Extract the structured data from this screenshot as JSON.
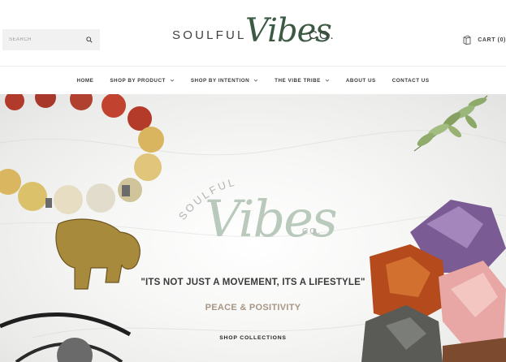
{
  "header": {
    "search": {
      "placeholder": "SEARCH",
      "icon": "search-icon"
    },
    "logo": {
      "word1": "SOULFUL",
      "word2": "Vibes",
      "word3": "CO."
    },
    "cart": {
      "label": "CART (0)",
      "icon": "cart-icon"
    }
  },
  "nav": {
    "items": [
      {
        "label": "HOME",
        "dropdown": false
      },
      {
        "label": "SHOP BY PRODUCT",
        "dropdown": true
      },
      {
        "label": "SHOP BY INTENTION",
        "dropdown": true
      },
      {
        "label": "THE VIBE TRIBE",
        "dropdown": true
      },
      {
        "label": "ABOUT US",
        "dropdown": false
      },
      {
        "label": "CONTACT US",
        "dropdown": false
      }
    ]
  },
  "hero": {
    "logo": {
      "word1": "SOULFUL",
      "word2": "Vibes",
      "word3": "CO."
    },
    "quote": "\"ITS NOT JUST A MOVEMENT, ITS A LIFESTYLE\"",
    "tagline": "PEACE & POSITIVITY",
    "cta": "SHOP COLLECTIONS"
  },
  "colors": {
    "brand_green": "#3c5a43",
    "hero_logo_green": "#b9c9bb",
    "tagline_tan": "#a79683"
  }
}
